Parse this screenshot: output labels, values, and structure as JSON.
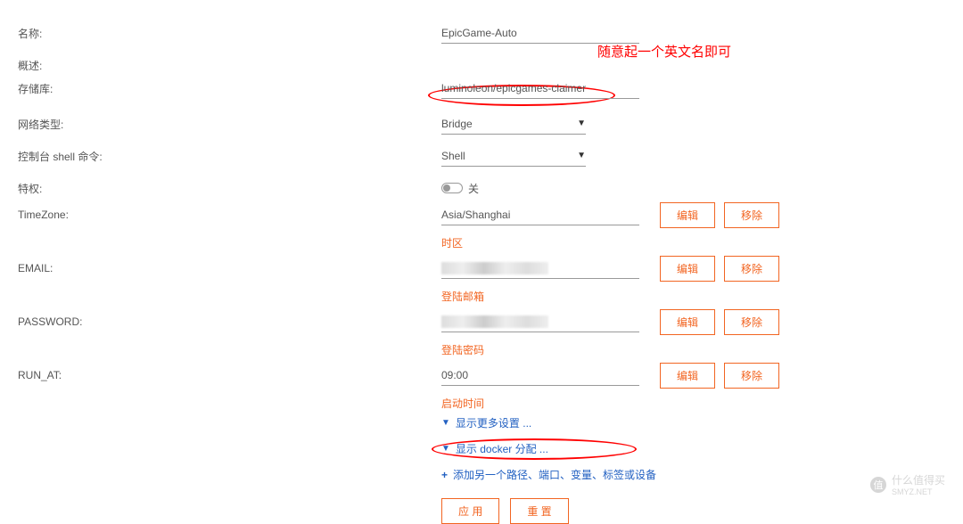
{
  "annotation": "随意起一个英文名即可",
  "labels": {
    "name": "名称:",
    "overview": "概述:",
    "repository": "存储库:",
    "network_type": "网络类型:",
    "console_cmd": "控制台 shell 命令:",
    "privilege": "特权:",
    "timezone": "TimeZone:",
    "email": "EMAIL:",
    "password": "PASSWORD:",
    "run_at": "RUN_AT:"
  },
  "values": {
    "name": "EpicGame-Auto",
    "repository": "luminoleon/epicgames-claimer",
    "network_type": "Bridge",
    "console_cmd": "Shell",
    "toggle_off": "关",
    "timezone": "Asia/Shanghai",
    "run_at": "09:00"
  },
  "sub_labels": {
    "timezone": "时区",
    "email": "登陆邮箱",
    "password": "登陆密码",
    "run_at": "启动时间"
  },
  "buttons": {
    "edit": "编辑",
    "remove": "移除",
    "apply": "应 用",
    "reset": "重 置"
  },
  "links": {
    "more_settings": "显示更多设置 ...",
    "docker_alloc": "显示 docker 分配 ...",
    "add_another": "添加另一个路径、端口、变量、标签或设备"
  },
  "watermark": {
    "text1": "值 ",
    "text2": "什么值得买",
    "text3": "SMYZ.NET"
  }
}
